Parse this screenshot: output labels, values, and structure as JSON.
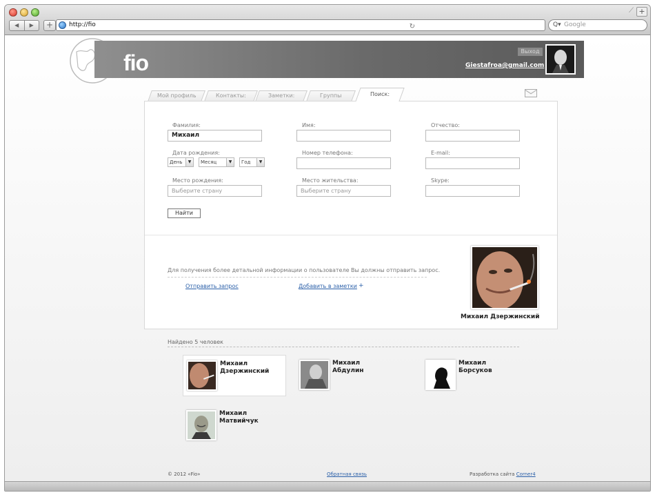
{
  "browser": {
    "url": "http://fio",
    "search_placeholder": "Google",
    "back_icon": "◀",
    "forward_icon": "▶",
    "add_icon": "+",
    "reload_icon": "↻",
    "search_icon": "Q▾",
    "new_tab_icon": "+"
  },
  "header": {
    "logo": "fio",
    "logout": "Выход",
    "email": "Giestafroa@gmail.com"
  },
  "tabs": [
    {
      "label": "Мой профиль"
    },
    {
      "label": "Контакты:"
    },
    {
      "label": "Заметки:"
    },
    {
      "label": "Группы"
    },
    {
      "label": "Поиск:"
    }
  ],
  "form": {
    "surname_label": "Фамилия:",
    "surname_value": "Михаил",
    "name_label": "Имя:",
    "patronymic_label": "Отчество:",
    "birthdate_label": "Дата рождения:",
    "day": "День",
    "month": "Месяц",
    "year": "Год",
    "phone_label": "Номер телефона:",
    "email_label": "E-mail:",
    "birthplace_label": "Место рождения:",
    "birthplace_placeholder": "Выберите страну",
    "residence_label": "Место жительства:",
    "residence_placeholder": "Выберите страну",
    "skype_label": "Skype:",
    "find_button": "Найти"
  },
  "detail": {
    "info": "Для получения более детальной информации о пользователе Вы должны отправить запрос.",
    "send_request": "Отправить запрос",
    "add_notes": "Добавить в заметки",
    "add_plus": "+",
    "name": "Михаил Дзержинский"
  },
  "results": {
    "found_text": "Найдено 5 человек",
    "people": [
      {
        "first": "Михаил",
        "last": "Дзержинский"
      },
      {
        "first": "Михаил",
        "last": "Абдулин"
      },
      {
        "first": "Михаил",
        "last": "Борсуков"
      },
      {
        "first": "Михаил",
        "last": "Матвийчук"
      }
    ]
  },
  "footer": {
    "copyright": "© 2012 «Fio»",
    "feedback": "Обратная связь",
    "dev_prefix": "Разработка сайта",
    "dev_link": "Corner4"
  }
}
